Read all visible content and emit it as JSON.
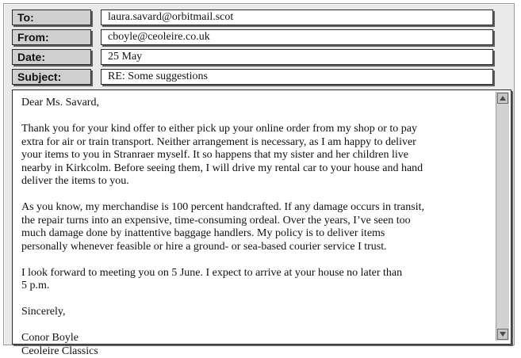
{
  "header": {
    "to_label": "To:",
    "to_value": "laura.savard@orbitmail.scot",
    "from_label": "From:",
    "from_value": "cboyle@ceoleire.co.uk",
    "date_label": "Date:",
    "date_value": "25 May",
    "subject_label": "Subject:",
    "subject_value": "RE: Some suggestions"
  },
  "body": {
    "greeting": "Dear Ms. Savard,",
    "paragraph1": [
      "Thank you for your kind offer to either pick up your online order from my shop or to pay",
      "extra for air or train transport. Neither arrangement is necessary, as I am happy to deliver",
      "your items to you in Stranraer myself. It so happens that my sister and her children live",
      "nearby in Kirkcolm. Before seeing them, I will drive my rental car to your house and hand",
      "deliver the items to you."
    ],
    "paragraph2": [
      "As you know, my merchandise is 100 percent handcrafted. If any damage occurs in transit,",
      "the repair turns into an expensive, time-consuming ordeal. Over the years, I’ve seen too",
      "much damage done by inattentive baggage handlers. My policy is to deliver items",
      "personally whenever feasible or hire a ground- or sea-based courier service I trust."
    ],
    "paragraph3": [
      "I look forward to meeting you on 5 June. I expect to arrive at your house no later than",
      "5 p.m."
    ],
    "closing": "Sincerely,",
    "signature_name": "Conor Boyle",
    "signature_company": "Ceoleire Classics"
  },
  "scrollbar": {
    "up_icon": "arrow-up-icon",
    "down_icon": "arrow-down-icon"
  }
}
